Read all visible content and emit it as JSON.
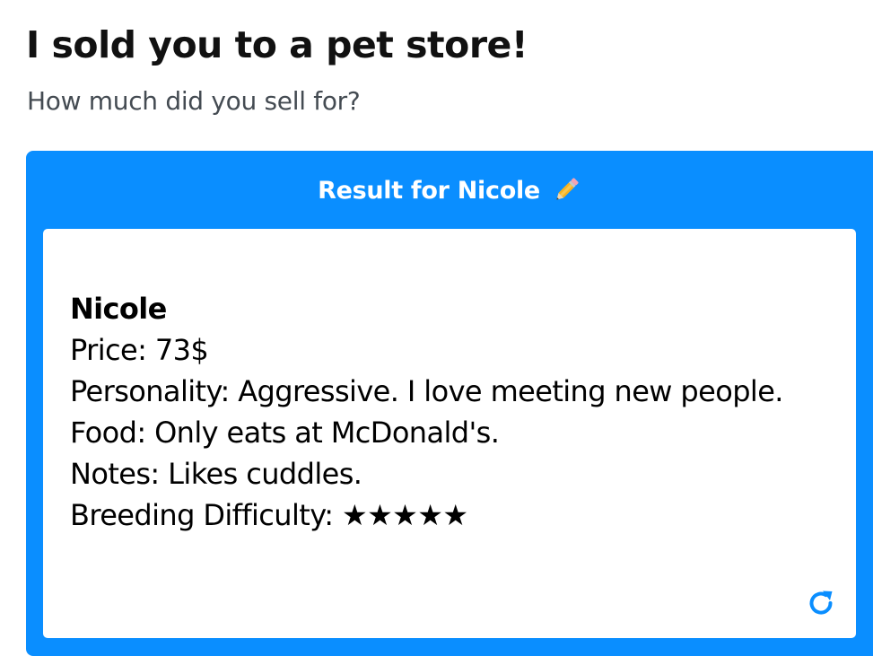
{
  "header": {
    "title": "I sold you to a pet store!",
    "subtitle": "How much did you sell for?"
  },
  "result": {
    "heading": "Result for Nicole",
    "edit_icon": "pencil-icon",
    "name": "Nicole",
    "lines": {
      "price": "Price: 73$",
      "personality": "Personality: Aggressive. I love meeting new people.",
      "food": "Food: Only eats at McDonald's.",
      "notes": "Notes: Likes cuddles.",
      "breeding": "Breeding Difficulty: ★★★★★"
    },
    "breeding_difficulty_stars": 5,
    "refresh_icon": "refresh-icon"
  },
  "colors": {
    "accent": "#0a8eff",
    "card_body": "#ffffff",
    "title_text": "#111111",
    "subtitle_text": "#444b52"
  }
}
